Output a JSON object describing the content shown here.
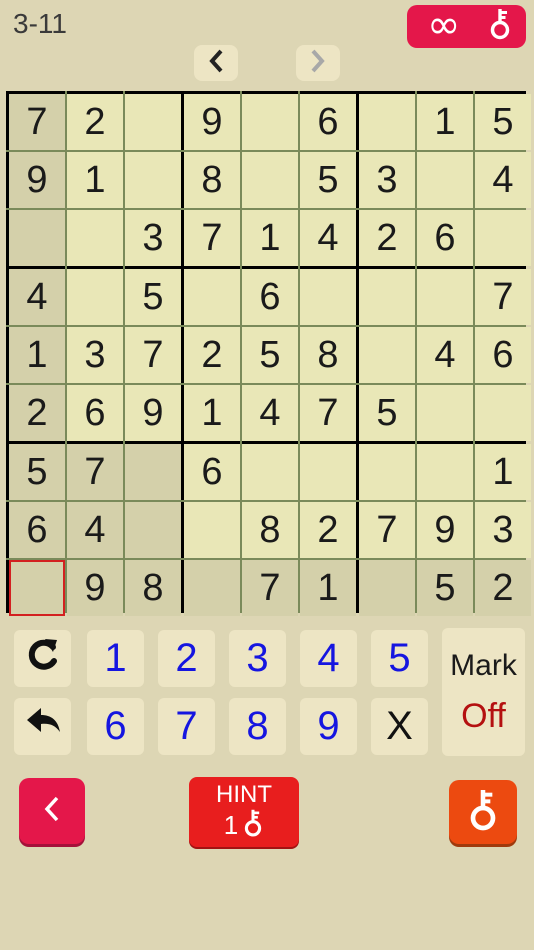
{
  "header": {
    "level": "3-11",
    "keys_count": "∞"
  },
  "board": {
    "rows": [
      [
        "7",
        "2",
        "",
        "9",
        "",
        "6",
        "",
        "1",
        "5"
      ],
      [
        "9",
        "1",
        "",
        "8",
        "",
        "5",
        "3",
        "",
        "4"
      ],
      [
        "",
        "",
        "3",
        "7",
        "1",
        "4",
        "2",
        "6",
        ""
      ],
      [
        "4",
        "",
        "5",
        "",
        "6",
        "",
        "",
        "",
        "7"
      ],
      [
        "1",
        "3",
        "7",
        "2",
        "5",
        "8",
        "",
        "4",
        "6"
      ],
      [
        "2",
        "6",
        "9",
        "1",
        "4",
        "7",
        "5",
        "",
        ""
      ],
      [
        "5",
        "7",
        "",
        "6",
        "",
        "",
        "",
        "",
        "1"
      ],
      [
        "6",
        "4",
        "",
        "",
        "8",
        "2",
        "7",
        "9",
        "3"
      ],
      [
        "",
        "9",
        "8",
        "",
        "7",
        "1",
        "",
        "5",
        "2"
      ]
    ],
    "selected": [
      8,
      0
    ]
  },
  "keypad": {
    "row1": [
      "1",
      "2",
      "3",
      "4",
      "5"
    ],
    "row2": [
      "6",
      "7",
      "8",
      "9",
      "X"
    ],
    "mark_label": "Mark",
    "mark_state": "Off"
  },
  "footer": {
    "hint_label": "HINT",
    "hint_cost": "1"
  },
  "colors": {
    "accent": "#e4174a",
    "hint": "#e81e1e",
    "key": "#ec4a10",
    "digit": "#1515e0"
  }
}
